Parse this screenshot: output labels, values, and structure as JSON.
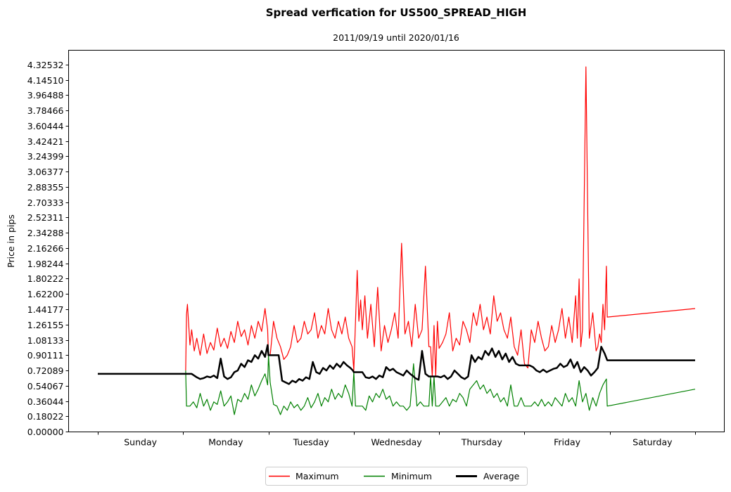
{
  "chart_data": {
    "type": "line",
    "title": "Spread verfication for US500_SPREAD_HIGH",
    "subtitle": "2011/09/19 until 2020/01/16",
    "xlabel": "",
    "ylabel": "Price in pips",
    "xlim": [
      -0.35,
      7.35
    ],
    "ylim": [
      0.0,
      4.5
    ],
    "grid": false,
    "legend_position": "bottom-center",
    "x_unit": "days since Sunday 00:00",
    "x_ticks": [
      0,
      1,
      2,
      3,
      4,
      5,
      6,
      7
    ],
    "x_tick_labels": [
      "Sunday",
      "Monday",
      "Tuesday",
      "Wednesday",
      "Thursday",
      "Friday",
      "Saturday"
    ],
    "y_ticks": [
      0.0,
      0.18022,
      0.36044,
      0.54067,
      0.72089,
      0.90111,
      1.08133,
      1.26155,
      1.44177,
      1.622,
      1.80222,
      1.98244,
      2.16266,
      2.34288,
      2.52311,
      2.70333,
      2.88355,
      3.06377,
      3.24399,
      3.42421,
      3.60444,
      3.78466,
      3.96488,
      4.1451,
      4.32532
    ],
    "y_tick_labels": [
      "0.00000",
      "0.18022",
      "0.36044",
      "0.54067",
      "0.72089",
      "0.90111",
      "1.08133",
      "1.26155",
      "1.44177",
      "1.62200",
      "1.80222",
      "1.98244",
      "2.16266",
      "2.34288",
      "2.52311",
      "2.70333",
      "2.88355",
      "3.06377",
      "3.24399",
      "3.42421",
      "3.60444",
      "3.78466",
      "3.96488",
      "4.14510",
      "4.32532"
    ],
    "series": [
      {
        "name": "Maximum",
        "color": "#ff0000",
        "x": [
          1.03,
          1.04,
          1.05,
          1.08,
          1.1,
          1.13,
          1.16,
          1.2,
          1.24,
          1.28,
          1.32,
          1.36,
          1.4,
          1.44,
          1.48,
          1.52,
          1.56,
          1.6,
          1.64,
          1.68,
          1.72,
          1.76,
          1.8,
          1.84,
          1.88,
          1.92,
          1.96,
          1.99,
          2.0,
          2.02,
          2.06,
          2.1,
          2.14,
          2.18,
          2.22,
          2.26,
          2.3,
          2.34,
          2.38,
          2.42,
          2.46,
          2.5,
          2.54,
          2.58,
          2.62,
          2.66,
          2.7,
          2.74,
          2.78,
          2.82,
          2.86,
          2.9,
          2.94,
          2.98,
          3.0,
          3.02,
          3.04,
          3.06,
          3.08,
          3.1,
          3.13,
          3.16,
          3.2,
          3.24,
          3.28,
          3.32,
          3.36,
          3.4,
          3.44,
          3.48,
          3.52,
          3.56,
          3.6,
          3.64,
          3.68,
          3.72,
          3.76,
          3.8,
          3.84,
          3.88,
          3.9,
          3.92,
          3.94,
          3.96,
          3.98,
          4.0,
          4.04,
          4.08,
          4.12,
          4.16,
          4.2,
          4.24,
          4.28,
          4.32,
          4.36,
          4.4,
          4.44,
          4.48,
          4.52,
          4.56,
          4.6,
          4.64,
          4.68,
          4.72,
          4.76,
          4.8,
          4.84,
          4.88,
          4.92,
          4.96,
          5.0,
          5.04,
          5.08,
          5.12,
          5.16,
          5.2,
          5.24,
          5.28,
          5.32,
          5.36,
          5.4,
          5.44,
          5.48,
          5.52,
          5.56,
          5.6,
          5.62,
          5.64,
          5.66,
          5.68,
          5.72,
          5.76,
          5.8,
          5.84,
          5.86,
          5.88,
          5.9,
          5.92,
          5.94,
          5.96,
          5.97,
          7.0
        ],
        "y": [
          0.72,
          1.38,
          1.5,
          1.02,
          1.2,
          0.95,
          1.1,
          0.9,
          1.15,
          0.92,
          1.05,
          0.96,
          1.22,
          1.0,
          1.1,
          0.98,
          1.18,
          1.05,
          1.3,
          1.12,
          1.2,
          1.02,
          1.25,
          1.1,
          1.3,
          1.18,
          1.45,
          1.2,
          0.9,
          0.9,
          1.3,
          1.1,
          1.0,
          0.85,
          0.9,
          1.0,
          1.25,
          1.05,
          1.1,
          1.3,
          1.15,
          1.2,
          1.4,
          1.1,
          1.25,
          1.15,
          1.45,
          1.2,
          1.1,
          1.3,
          1.15,
          1.35,
          1.1,
          1.0,
          0.72,
          1.3,
          1.9,
          1.3,
          1.55,
          1.2,
          1.6,
          1.1,
          1.5,
          1.0,
          1.7,
          0.95,
          1.25,
          1.05,
          1.2,
          1.4,
          1.1,
          2.22,
          1.15,
          1.3,
          1.0,
          1.5,
          1.1,
          1.2,
          1.95,
          1.0,
          1.0,
          0.65,
          1.25,
          0.65,
          1.3,
          0.98,
          1.05,
          1.15,
          1.4,
          0.95,
          1.1,
          1.02,
          1.3,
          1.2,
          1.05,
          1.4,
          1.25,
          1.5,
          1.2,
          1.35,
          1.15,
          1.6,
          1.3,
          1.4,
          1.2,
          1.1,
          1.35,
          1.0,
          0.9,
          1.2,
          0.8,
          0.75,
          1.2,
          1.05,
          1.3,
          1.1,
          0.95,
          1.0,
          1.25,
          1.05,
          1.2,
          1.45,
          1.1,
          1.35,
          1.05,
          1.6,
          1.1,
          1.8,
          1.0,
          1.2,
          4.3,
          1.1,
          1.4,
          0.95,
          1.0,
          1.15,
          1.05,
          1.5,
          1.2,
          1.95,
          1.35,
          1.45,
          1.18,
          1.18,
          1.18
        ]
      },
      {
        "name": "Minimum",
        "color": "#008000",
        "x": [
          1.03,
          1.04,
          1.08,
          1.12,
          1.16,
          1.2,
          1.24,
          1.28,
          1.32,
          1.36,
          1.4,
          1.44,
          1.48,
          1.52,
          1.56,
          1.6,
          1.64,
          1.68,
          1.72,
          1.76,
          1.8,
          1.84,
          1.88,
          1.92,
          1.96,
          1.99,
          2.0,
          2.02,
          2.06,
          2.1,
          2.14,
          2.18,
          2.22,
          2.26,
          2.3,
          2.34,
          2.38,
          2.42,
          2.46,
          2.5,
          2.54,
          2.58,
          2.62,
          2.66,
          2.7,
          2.74,
          2.78,
          2.82,
          2.86,
          2.9,
          2.94,
          2.98,
          3.0,
          3.02,
          3.06,
          3.1,
          3.14,
          3.18,
          3.22,
          3.26,
          3.3,
          3.34,
          3.38,
          3.42,
          3.46,
          3.5,
          3.54,
          3.58,
          3.62,
          3.66,
          3.7,
          3.74,
          3.78,
          3.82,
          3.86,
          3.88,
          3.9,
          3.92,
          3.94,
          3.96,
          3.98,
          4.0,
          4.04,
          4.08,
          4.12,
          4.16,
          4.2,
          4.24,
          4.28,
          4.32,
          4.36,
          4.4,
          4.44,
          4.48,
          4.52,
          4.56,
          4.6,
          4.64,
          4.68,
          4.72,
          4.76,
          4.8,
          4.84,
          4.88,
          4.92,
          4.96,
          5.0,
          5.04,
          5.08,
          5.12,
          5.16,
          5.2,
          5.24,
          5.28,
          5.32,
          5.36,
          5.4,
          5.44,
          5.48,
          5.52,
          5.56,
          5.6,
          5.64,
          5.68,
          5.72,
          5.76,
          5.8,
          5.84,
          5.88,
          5.92,
          5.96,
          5.97,
          7.0
        ],
        "y": [
          0.72,
          0.3,
          0.3,
          0.35,
          0.28,
          0.45,
          0.3,
          0.38,
          0.25,
          0.35,
          0.32,
          0.48,
          0.3,
          0.35,
          0.42,
          0.2,
          0.38,
          0.35,
          0.45,
          0.38,
          0.55,
          0.42,
          0.5,
          0.6,
          0.68,
          0.55,
          0.9,
          0.58,
          0.32,
          0.3,
          0.2,
          0.3,
          0.25,
          0.35,
          0.28,
          0.32,
          0.25,
          0.3,
          0.4,
          0.28,
          0.35,
          0.45,
          0.3,
          0.4,
          0.35,
          0.5,
          0.38,
          0.45,
          0.4,
          0.55,
          0.45,
          0.3,
          0.7,
          0.3,
          0.3,
          0.3,
          0.25,
          0.42,
          0.35,
          0.45,
          0.4,
          0.5,
          0.38,
          0.42,
          0.3,
          0.35,
          0.3,
          0.3,
          0.25,
          0.3,
          0.8,
          0.3,
          0.35,
          0.3,
          0.3,
          0.3,
          0.65,
          0.3,
          0.65,
          0.3,
          0.3,
          0.3,
          0.35,
          0.4,
          0.3,
          0.38,
          0.35,
          0.45,
          0.4,
          0.3,
          0.5,
          0.55,
          0.6,
          0.5,
          0.55,
          0.45,
          0.5,
          0.4,
          0.45,
          0.35,
          0.4,
          0.3,
          0.55,
          0.3,
          0.3,
          0.4,
          0.3,
          0.3,
          0.3,
          0.35,
          0.3,
          0.38,
          0.3,
          0.35,
          0.3,
          0.4,
          0.35,
          0.3,
          0.45,
          0.35,
          0.4,
          0.3,
          0.6,
          0.35,
          0.45,
          0.25,
          0.4,
          0.3,
          0.45,
          0.55,
          0.62,
          0.3,
          0.5,
          0.5
        ]
      },
      {
        "name": "Average",
        "color": "#000000",
        "x": [
          0.0,
          1.1,
          1.16,
          1.2,
          1.24,
          1.28,
          1.32,
          1.36,
          1.4,
          1.44,
          1.48,
          1.52,
          1.56,
          1.6,
          1.64,
          1.68,
          1.72,
          1.76,
          1.8,
          1.84,
          1.88,
          1.92,
          1.96,
          1.99,
          2.0,
          2.12,
          2.16,
          2.2,
          2.24,
          2.28,
          2.32,
          2.36,
          2.4,
          2.44,
          2.48,
          2.52,
          2.56,
          2.6,
          2.64,
          2.68,
          2.72,
          2.76,
          2.8,
          2.84,
          2.88,
          2.92,
          2.96,
          2.99,
          3.0,
          3.1,
          3.14,
          3.18,
          3.22,
          3.26,
          3.3,
          3.34,
          3.38,
          3.42,
          3.46,
          3.5,
          3.54,
          3.58,
          3.62,
          3.66,
          3.7,
          3.72,
          3.76,
          3.8,
          3.84,
          3.88,
          3.9,
          3.98,
          4.02,
          4.06,
          4.1,
          4.14,
          4.18,
          4.22,
          4.26,
          4.3,
          4.34,
          4.38,
          4.42,
          4.46,
          4.5,
          4.54,
          4.58,
          4.62,
          4.66,
          4.7,
          4.74,
          4.78,
          4.82,
          4.86,
          4.9,
          4.94,
          5.02,
          5.06,
          5.1,
          5.14,
          5.18,
          5.22,
          5.26,
          5.3,
          5.34,
          5.38,
          5.42,
          5.46,
          5.5,
          5.54,
          5.58,
          5.62,
          5.66,
          5.7,
          5.74,
          5.78,
          5.82,
          5.86,
          5.9,
          5.94,
          5.97,
          7.0
        ],
        "y": [
          0.68,
          0.68,
          0.64,
          0.62,
          0.63,
          0.65,
          0.64,
          0.66,
          0.63,
          0.86,
          0.65,
          0.62,
          0.64,
          0.7,
          0.72,
          0.8,
          0.76,
          0.84,
          0.82,
          0.9,
          0.86,
          0.95,
          0.88,
          1.02,
          0.9,
          0.9,
          0.6,
          0.58,
          0.56,
          0.6,
          0.58,
          0.62,
          0.6,
          0.64,
          0.62,
          0.82,
          0.7,
          0.68,
          0.75,
          0.72,
          0.78,
          0.74,
          0.8,
          0.76,
          0.82,
          0.78,
          0.75,
          0.72,
          0.7,
          0.7,
          0.64,
          0.63,
          0.65,
          0.62,
          0.66,
          0.64,
          0.76,
          0.72,
          0.74,
          0.7,
          0.68,
          0.66,
          0.72,
          0.68,
          0.65,
          0.63,
          0.61,
          0.95,
          0.68,
          0.65,
          0.65,
          0.65,
          0.64,
          0.66,
          0.62,
          0.65,
          0.72,
          0.68,
          0.64,
          0.62,
          0.65,
          0.9,
          0.82,
          0.88,
          0.85,
          0.95,
          0.9,
          0.98,
          0.88,
          0.95,
          0.85,
          0.92,
          0.82,
          0.88,
          0.8,
          0.78,
          0.78,
          0.78,
          0.76,
          0.72,
          0.7,
          0.73,
          0.7,
          0.72,
          0.74,
          0.75,
          0.8,
          0.76,
          0.78,
          0.85,
          0.75,
          0.82,
          0.7,
          0.76,
          0.72,
          0.66,
          0.7,
          0.75,
          1.0,
          0.92,
          0.84,
          0.84
        ]
      }
    ],
    "legend": [
      "Maximum",
      "Minimum",
      "Average"
    ]
  }
}
